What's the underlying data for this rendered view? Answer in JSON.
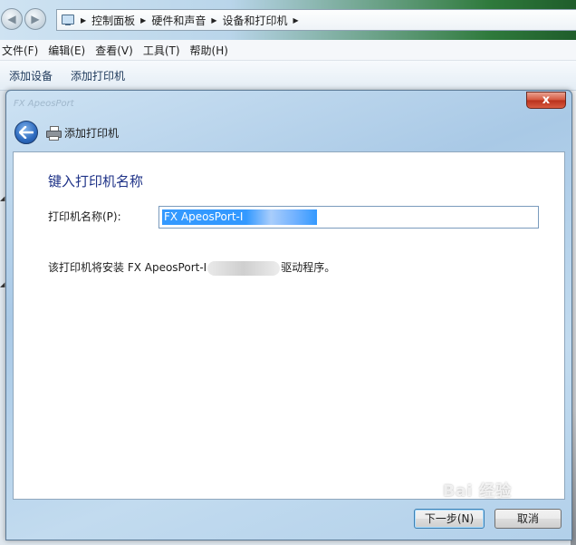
{
  "addressbar": {
    "crumbs": [
      "控制面板",
      "硬件和声音",
      "设备和打印机"
    ]
  },
  "menubar": {
    "items": [
      "文件(F)",
      "编辑(E)",
      "查看(V)",
      "工具(T)",
      "帮助(H)"
    ]
  },
  "commandbar": {
    "items": [
      "添加设备",
      "添加打印机"
    ]
  },
  "dialog": {
    "title": "添加打印机",
    "background_title": "FX ApeosPort",
    "heading": "键入打印机名称",
    "field_label": "打印机名称(P):",
    "printer_name_value": "FX ApeosPort-I",
    "driver_text_before": "该打印机将安装 FX ApeosPort-I",
    "driver_text_after": "驱动程序。",
    "next_button": "下一步(N)",
    "cancel_button": "取消",
    "close_glyph": "x"
  },
  "watermark": {
    "text": "Bai 经验"
  },
  "colors": {
    "heading": "#1e3287",
    "selection": "#3399ff",
    "close_button": "#c9452b"
  },
  "icons": [
    "back-arrow-icon",
    "forward-arrow-icon",
    "printer-icon",
    "computer-icon",
    "close-icon"
  ]
}
